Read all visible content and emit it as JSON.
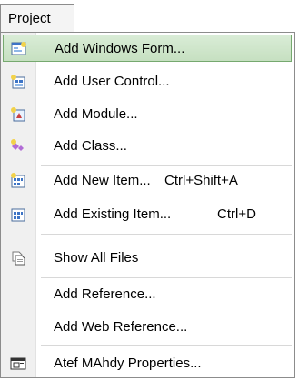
{
  "menubar": {
    "tab_label": "Project"
  },
  "menu": {
    "items": [
      {
        "label": "Add Windows Form...",
        "icon": "windows-form-icon",
        "shortcut": ""
      },
      {
        "label": "Add User Control...",
        "icon": "user-control-icon",
        "shortcut": ""
      },
      {
        "label": "Add Module...",
        "icon": "module-icon",
        "shortcut": ""
      },
      {
        "label": "Add Class...",
        "icon": "class-icon",
        "shortcut": ""
      },
      {
        "label": "Add New Item...",
        "icon": "new-item-icon",
        "shortcut": "Ctrl+Shift+A"
      },
      {
        "label": "Add Existing Item...",
        "icon": "existing-item-icon",
        "shortcut": "Ctrl+D"
      },
      {
        "label": "Show All Files",
        "icon": "show-all-files-icon",
        "shortcut": ""
      },
      {
        "label": "Add Reference...",
        "icon": "",
        "shortcut": ""
      },
      {
        "label": "Add Web Reference...",
        "icon": "",
        "shortcut": ""
      },
      {
        "label": "Atef MAhdy Properties...",
        "icon": "properties-icon",
        "shortcut": ""
      }
    ]
  },
  "colors": {
    "highlight_fill": "#c6e0c1",
    "highlight_border": "#76a96f",
    "gutter": "#f0f0f0"
  }
}
